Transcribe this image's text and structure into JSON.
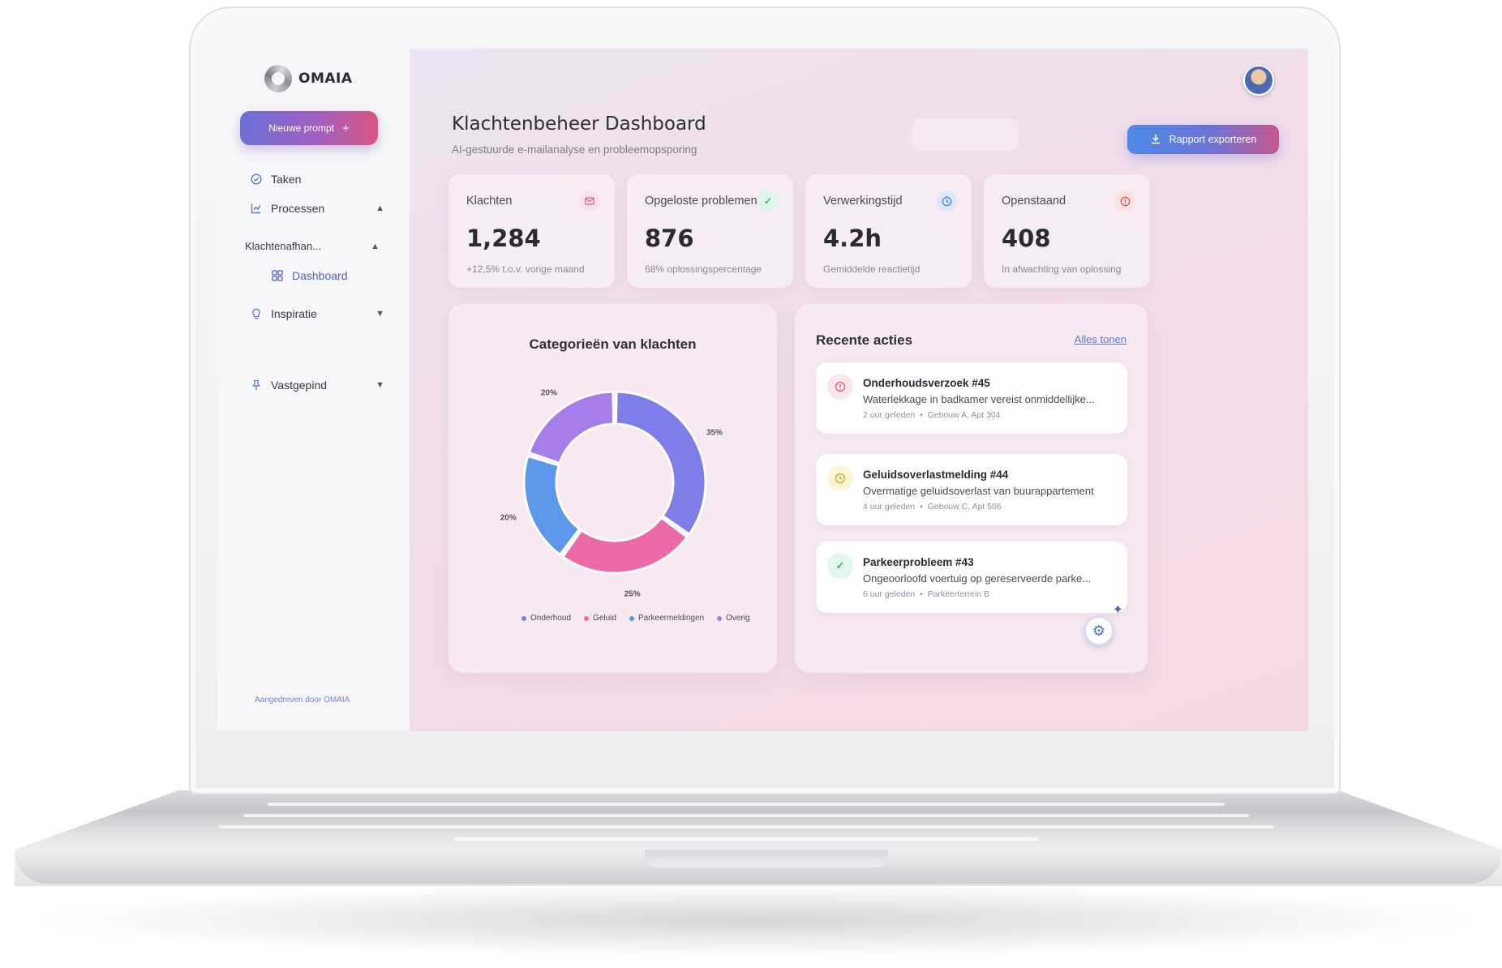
{
  "brand": {
    "name": "OMAIA"
  },
  "sidebar": {
    "new_prompt": "Nieuwe prompt",
    "items": [
      {
        "label": "Taken",
        "icon": "check-circle-icon"
      },
      {
        "label": "Processen",
        "icon": "process-icon"
      },
      {
        "label": "Klachtenafhan...",
        "icon": ""
      },
      {
        "label": "Dashboard",
        "icon": "grid-icon"
      },
      {
        "label": "Inspiratie",
        "icon": "bulb-icon"
      },
      {
        "label": "Vastgepind",
        "icon": "pin-icon"
      }
    ],
    "footer": "Aangedreven door OMAIA"
  },
  "header": {
    "title": "Klachtenbeheer Dashboard",
    "subtitle": "AI-gestuurde e-mailanalyse en probleemopsporing",
    "export_label": "Rapport exporteren"
  },
  "stats": [
    {
      "label": "Klachten",
      "value": "1,284",
      "note": "+12,5% t.o.v. vorige maand",
      "icon": "mail-icon",
      "color": "#e05a7f"
    },
    {
      "label": "Opgeloste problemen",
      "value": "876",
      "note": "68% oplossingspercentage",
      "icon": "check-icon",
      "color": "#3fb37a"
    },
    {
      "label": "Verwerkingstijd",
      "value": "4.2h",
      "note": "Gemiddelde reactietijd",
      "icon": "clock-icon",
      "color": "#4f7fe0"
    },
    {
      "label": "Openstaand",
      "value": "408",
      "note": "In afwachting van oplossing",
      "icon": "alert-icon",
      "color": "#e2574f"
    }
  ],
  "chart": {
    "title": "Categorieën van klachten"
  },
  "chart_data": {
    "type": "pie",
    "categories": [
      "Onderhoud",
      "Geluid",
      "Parkeermeldingen",
      "Overig"
    ],
    "values": [
      35,
      25,
      20,
      20
    ],
    "labels": [
      "35%",
      "25%",
      "20%",
      "20%"
    ],
    "colors": [
      "#7f7ee8",
      "#ec6aa8",
      "#5c97ec",
      "#a57ce8"
    ],
    "legend": "bottom"
  },
  "recent": {
    "title": "Recente acties",
    "view_all": "Alles tonen",
    "items": [
      {
        "title": "Onderhoudsverzoek #45",
        "desc": "Waterlekkage in badkamer vereist onmiddellijke...",
        "time": "2 uur geleden",
        "place": "Gebouw A, Apt 304",
        "icon": "alert-icon",
        "color": "#e05a6a",
        "bg": "#fde7ec"
      },
      {
        "title": "Geluidsoverlastmelding #44",
        "desc": "Overmatige geluidsoverlast van buurappartement",
        "time": "4 uur geleden",
        "place": "Gebouw C, Apt 506",
        "icon": "clock-icon",
        "color": "#d5a417",
        "bg": "#fdf5d8"
      },
      {
        "title": "Parkeerprobleem #43",
        "desc": "Ongeoorloofd voertuig op gereserveerde parke...",
        "time": "6 uur geleden",
        "place": "Parkeerterrein B",
        "icon": "check-icon",
        "color": "#3fb37a",
        "bg": "#e3f6ec"
      }
    ]
  }
}
